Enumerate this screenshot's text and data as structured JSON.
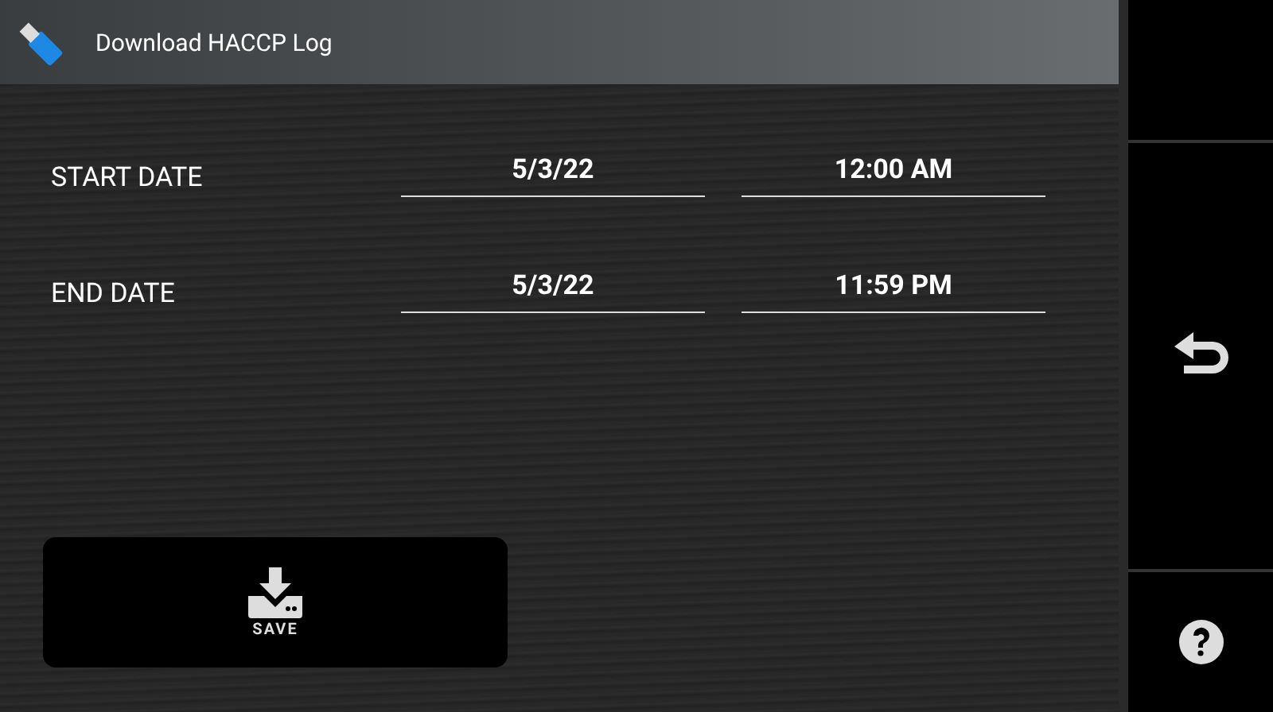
{
  "header": {
    "title": "Download HACCP Log"
  },
  "rows": [
    {
      "label": "START DATE",
      "date": "5/3/22",
      "time": "12:00 AM"
    },
    {
      "label": "END DATE",
      "date": "5/3/22",
      "time": "11:59 PM"
    }
  ],
  "save_button": {
    "label": "SAVE"
  }
}
